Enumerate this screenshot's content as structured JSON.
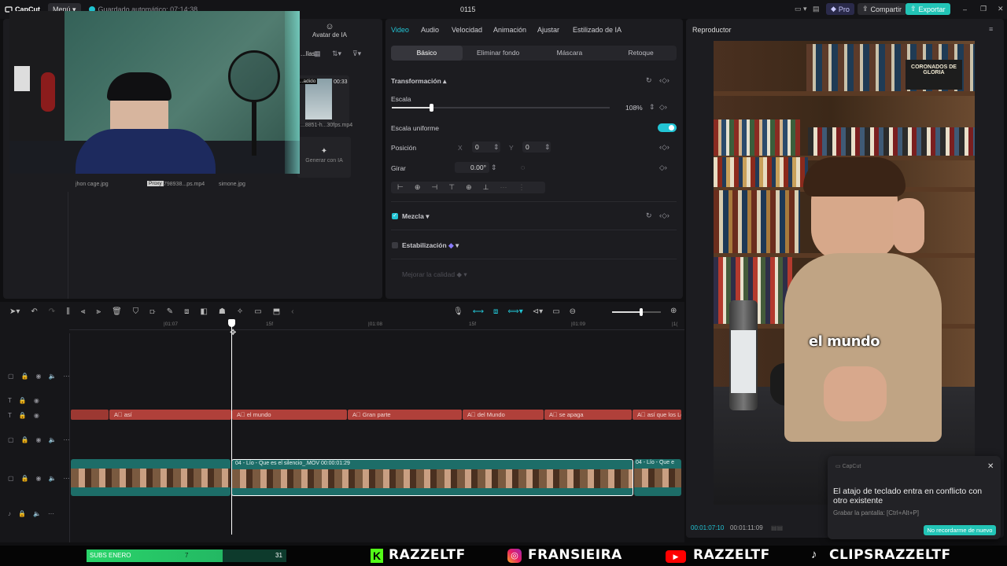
{
  "titlebar": {
    "app": "CapCut",
    "menu": "Menú",
    "autosave": "Guardado automático: 07:14:38",
    "project": "0115",
    "pro": "Pro",
    "share": "Compartir",
    "export": "Exportar"
  },
  "media": {
    "tabs": [
      "...llas",
      "Avatar de IA"
    ],
    "items": [
      {
        "name": "jhon cage.jpg"
      },
      {
        "name": "798938...ps.mp4",
        "badge": "Proxy"
      },
      {
        "name": "simone.jpg"
      },
      {
        "name": "...8851-h...30fps.mp4",
        "duration": "00:33",
        "badge": "...adido"
      }
    ],
    "generate": "Generar con IA"
  },
  "inspector": {
    "tabs": [
      "Video",
      "Audio",
      "Velocidad",
      "Animación",
      "Ajustar",
      "Estilizado de IA"
    ],
    "active_tab": "Video",
    "subtabs": [
      "Básico",
      "Eliminar fondo",
      "Máscara",
      "Retoque"
    ],
    "active_subtab": "Básico",
    "transform_label": "Transformación",
    "scale_label": "Escala",
    "scale_value": "108%",
    "scale_fraction": 0.18,
    "uniform_label": "Escala uniforme",
    "uniform_on": true,
    "position_label": "Posición",
    "x_label": "X",
    "x_value": "0",
    "y_label": "Y",
    "y_value": "0",
    "rotate_label": "Girar",
    "rotate_value": "0.00°",
    "blend_label": "Mezcla",
    "stabilize_label": "Estabilización",
    "quality_label": "Mejorar la calidad"
  },
  "player": {
    "title": "Reproductor",
    "caption": "el mundo",
    "current_time": "00:01:07:10",
    "total_time": "00:01:11:09",
    "book_title": "CORONADOS DE GLORIA"
  },
  "toast": {
    "app": "CapCut",
    "message": "El atajo de teclado entra en conflicto con otro existente",
    "detail": "Grabar la pantalla: [Ctrl+Alt+P]",
    "button": "No recordarme de nuevo"
  },
  "timeline": {
    "ruler": [
      "|01:07",
      "15f",
      "|01:08",
      "15f",
      "|01:09",
      "|1("
    ],
    "captions": [
      "así",
      "el mundo",
      "Gran parte",
      "del Mundo",
      "se apaga",
      "así que los Lec"
    ],
    "video_clip": "04 - Lío - Que es el silencio_.MOV  00:00:01:29",
    "next_clip": "04 - Lío - Que e"
  },
  "overlay": {
    "subs_label": "SUBS ENERO",
    "subs_current": "7",
    "subs_goal": "31",
    "subs_fraction": 0.68,
    "socials": [
      "RAZZELTF",
      "FRANSIEIRA",
      "RAZZELTF",
      "CLIPSRAZZELTF"
    ]
  },
  "colors": {
    "accent": "#1fc2d0",
    "caption_track": "#b0403a",
    "video_track": "#1d6d68",
    "export": "#22c4b6"
  }
}
